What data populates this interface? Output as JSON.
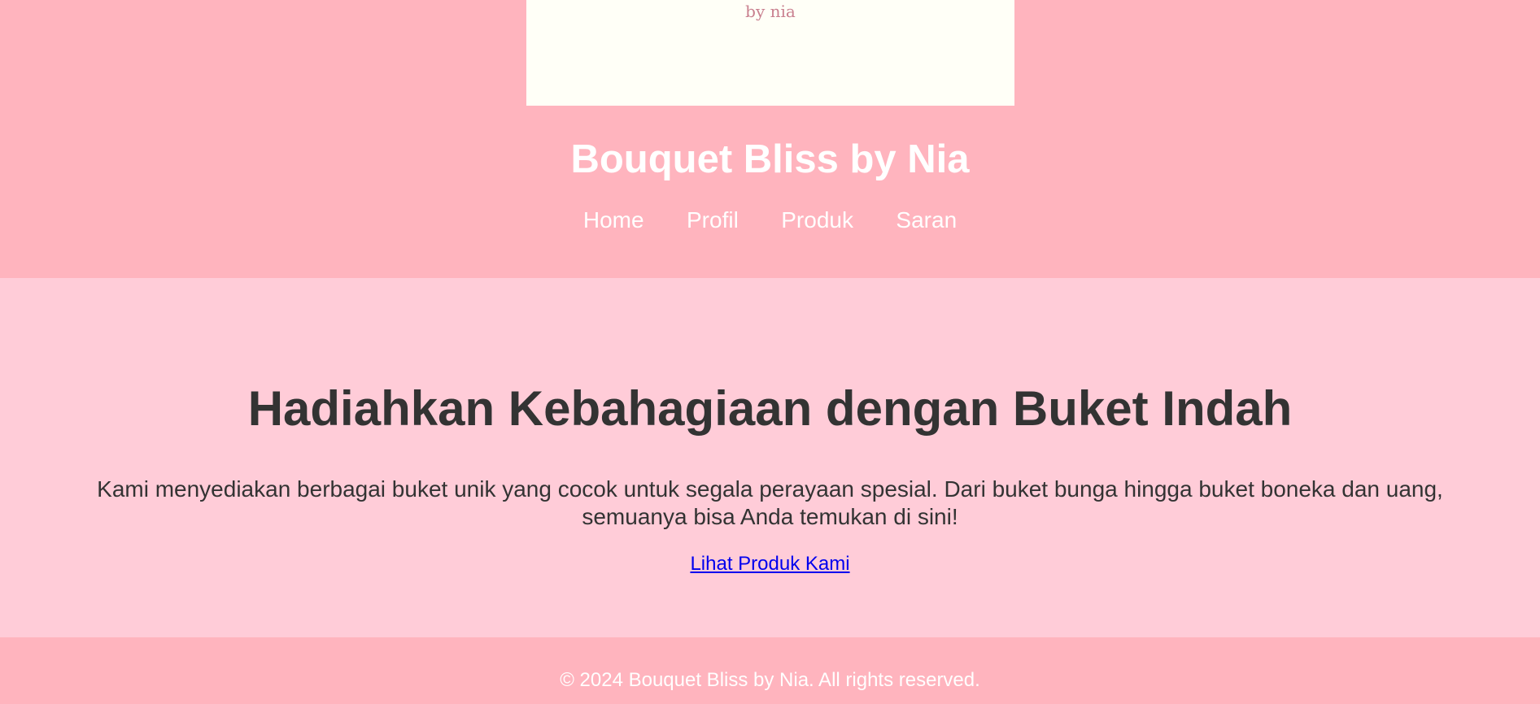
{
  "header": {
    "logo_text": "by nia",
    "site_title": "Bouquet Bliss by Nia",
    "nav": [
      {
        "label": "Home"
      },
      {
        "label": "Profil"
      },
      {
        "label": "Produk"
      },
      {
        "label": "Saran"
      }
    ]
  },
  "hero": {
    "heading": "Hadiahkan Kebahagiaan dengan Buket Indah",
    "description": "Kami menyediakan berbagai buket unik yang cocok untuk segala perayaan spesial. Dari buket bunga hingga buket boneka dan uang, semuanya bisa Anda temukan di sini!",
    "cta_label": "Lihat Produk Kami"
  },
  "footer": {
    "copyright": "© 2024 Bouquet Bliss by Nia. All rights reserved."
  },
  "colors": {
    "header_bg": "#ffb4be",
    "hero_bg": "#ffccd8",
    "logo_bg": "#fffff7",
    "text_dark": "#333333",
    "link": "#0000ee"
  }
}
